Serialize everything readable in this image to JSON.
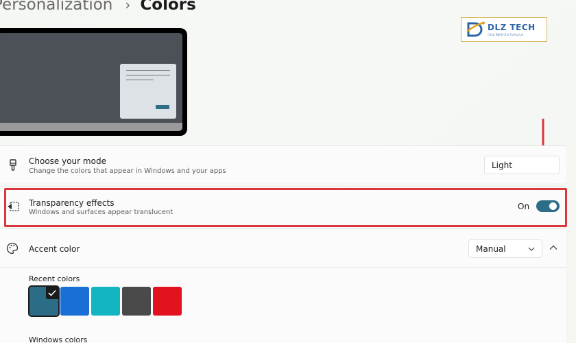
{
  "breadcrumb": {
    "parent": "Personalization",
    "separator": "›",
    "current": "Colors"
  },
  "logo": {
    "title": "DLZ TECH",
    "subtitle": "Công Nghệ Cho Tương Lai"
  },
  "mode": {
    "title": "Choose your mode",
    "description": "Change the colors that appear in Windows and your apps",
    "selected": "Light",
    "icon": "paintbrush-icon"
  },
  "transparency": {
    "title": "Transparency effects",
    "description": "Windows and surfaces appear translucent",
    "state_label": "On",
    "enabled": true,
    "icon": "transparency-icon"
  },
  "accent": {
    "title": "Accent color",
    "selected": "Manual",
    "icon": "palette-icon"
  },
  "recent_colors": {
    "label": "Recent colors",
    "swatches": [
      {
        "color": "#2b6d87",
        "selected": true
      },
      {
        "color": "#1a6fd6",
        "selected": false
      },
      {
        "color": "#13b5c2",
        "selected": false
      },
      {
        "color": "#4a4a4a",
        "selected": false
      },
      {
        "color": "#e3121f",
        "selected": false
      }
    ]
  },
  "windows_colors": {
    "label": "Windows colors"
  },
  "colors": {
    "accent": "#2e6d87",
    "highlight": "#d9363e"
  }
}
